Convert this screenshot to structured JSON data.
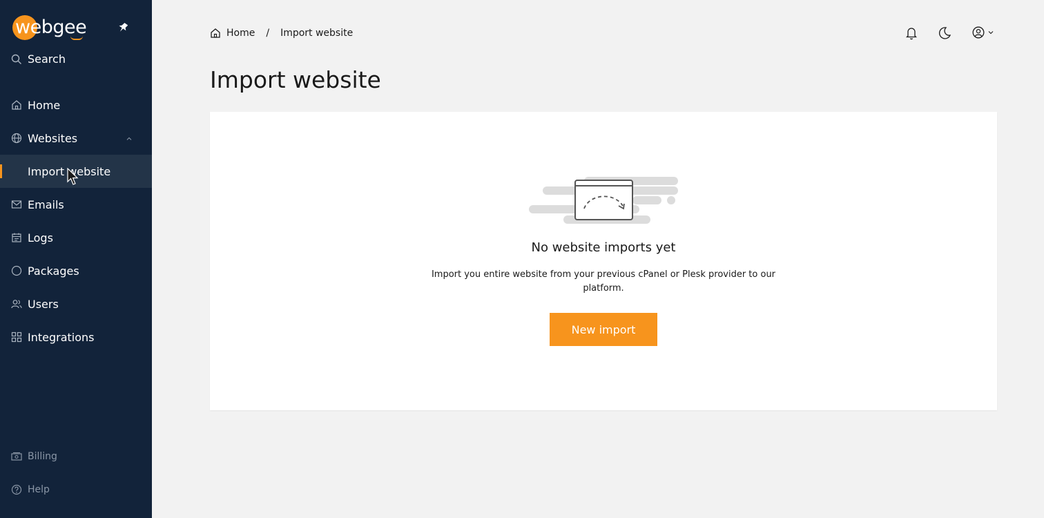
{
  "brand": {
    "name": "webgee",
    "accent": "#f7941d",
    "sidebar_bg": "#12233a"
  },
  "sidebar": {
    "search_label": "Search",
    "items": [
      {
        "label": "Home",
        "icon": "home-icon"
      },
      {
        "label": "Websites",
        "icon": "globe-icon"
      },
      {
        "label": "Import website",
        "icon": ""
      },
      {
        "label": "Emails",
        "icon": "mail-icon"
      },
      {
        "label": "Logs",
        "icon": "calendar-icon"
      },
      {
        "label": "Packages",
        "icon": "circle-icon"
      },
      {
        "label": "Users",
        "icon": "users-icon"
      },
      {
        "label": "Integrations",
        "icon": "grid-icon"
      }
    ],
    "bottom": [
      {
        "label": "Billing",
        "icon": "billing-icon"
      },
      {
        "label": "Help",
        "icon": "help-icon"
      }
    ]
  },
  "breadcrumb": {
    "home": "Home",
    "separator": "/",
    "current": "Import website"
  },
  "page": {
    "title": "Import website"
  },
  "empty_state": {
    "title": "No website imports yet",
    "description": "Import you entire website from your previous cPanel or Plesk provider to our platform.",
    "button": "New import"
  }
}
